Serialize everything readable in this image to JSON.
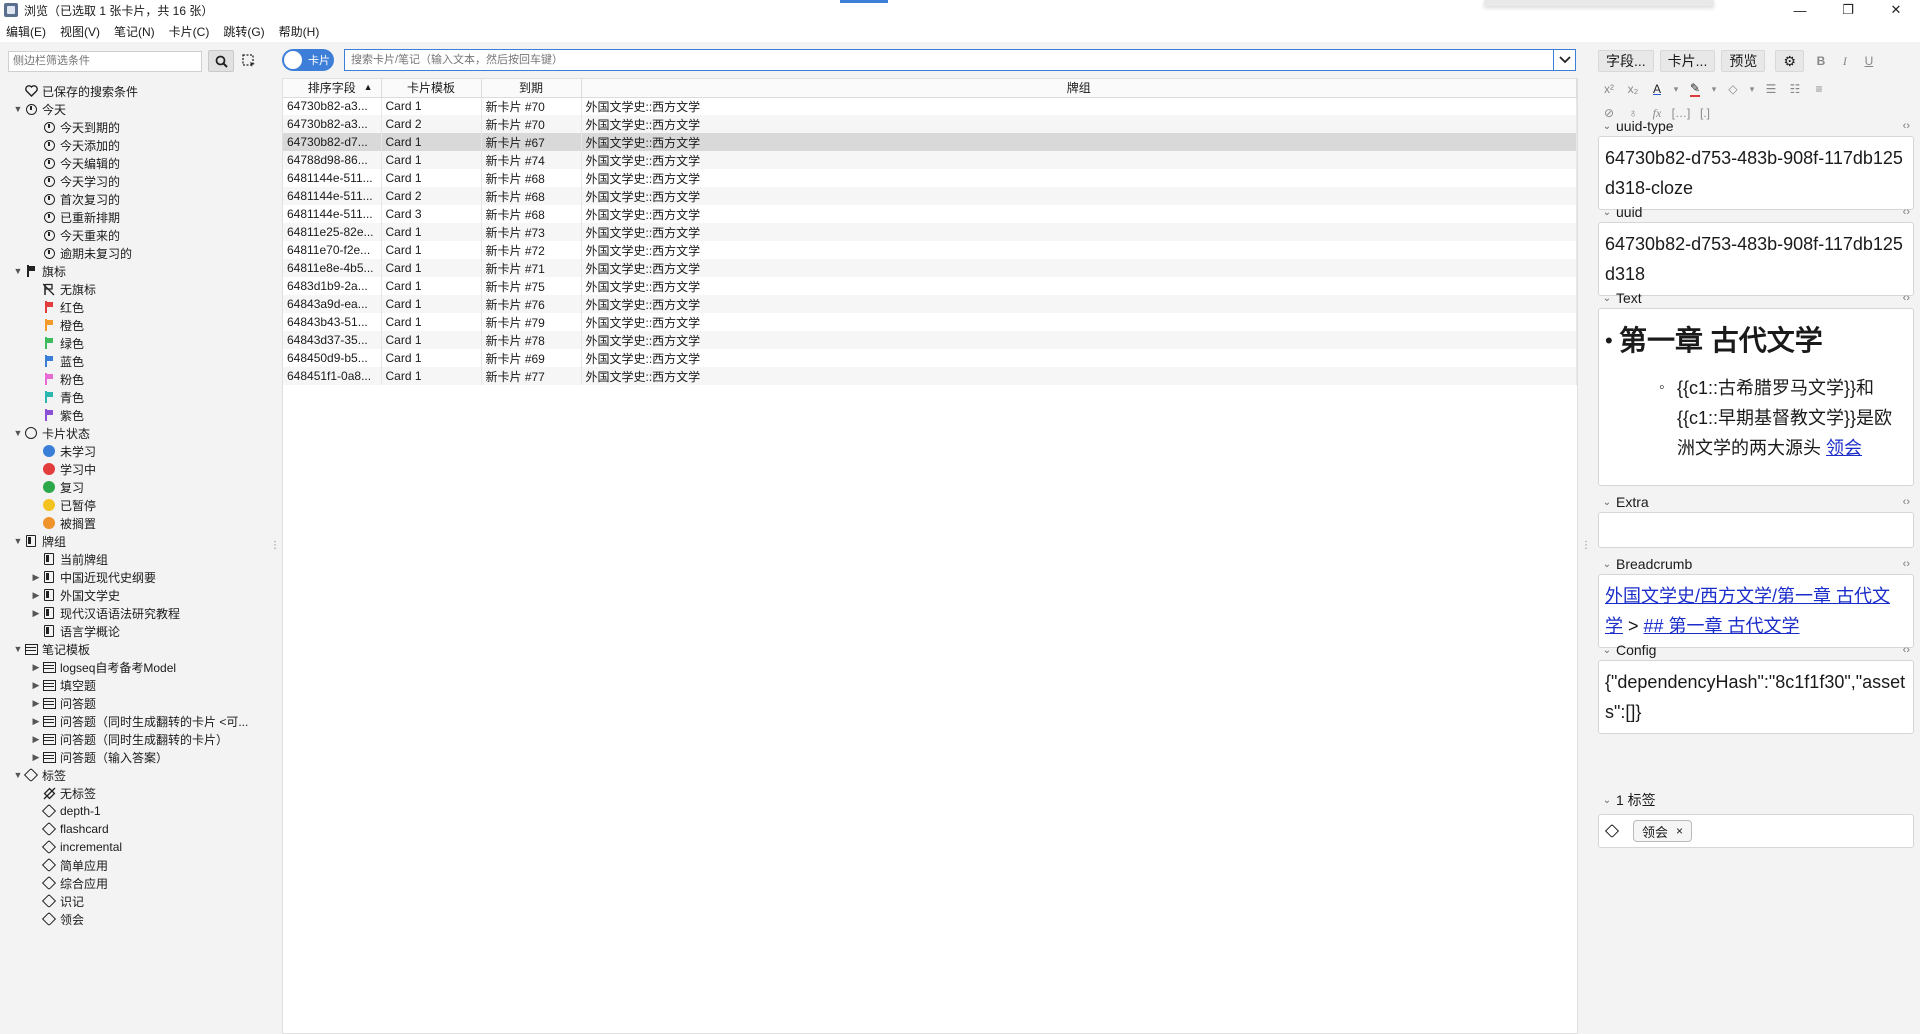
{
  "window": {
    "title": "浏览（已选取 1 张卡片，共 16 张）",
    "controls": [
      "—",
      "❐",
      "✕"
    ]
  },
  "menu": [
    "编辑(E)",
    "视图(V)",
    "笔记(N)",
    "卡片(C)",
    "跳转(G)",
    "帮助(H)"
  ],
  "sidebar": {
    "filter_placeholder": "侧边栏筛选条件",
    "saved_searches": "已保存的搜索条件",
    "today": {
      "label": "今天",
      "items": [
        "今天到期的",
        "今天添加的",
        "今天编辑的",
        "今天学习的",
        "首次复习的",
        "已重新排期",
        "今天重来的",
        "逾期未复习的"
      ]
    },
    "flags": {
      "label": "旗标",
      "items": [
        {
          "label": "无旗标",
          "color": "#222222"
        },
        {
          "label": "红色",
          "color": "#e23c3c"
        },
        {
          "label": "橙色",
          "color": "#f39a2a"
        },
        {
          "label": "绿色",
          "color": "#3dbb5d"
        },
        {
          "label": "蓝色",
          "color": "#3b7ed8"
        },
        {
          "label": "粉色",
          "color": "#e86ad5"
        },
        {
          "label": "青色",
          "color": "#2cb8b0"
        },
        {
          "label": "紫色",
          "color": "#8d4fd6"
        }
      ]
    },
    "card_state": {
      "label": "卡片状态",
      "items": [
        {
          "label": "未学习",
          "color": "#3b7ed8"
        },
        {
          "label": "学习中",
          "color": "#e23c3c"
        },
        {
          "label": "复习",
          "color": "#2aa84a"
        },
        {
          "label": "已暂停",
          "color": "#f5c31f"
        },
        {
          "label": "被搁置",
          "color": "#f0932a"
        }
      ]
    },
    "decks": {
      "label": "牌组",
      "items": [
        "当前牌组",
        "中国近现代史纲要",
        "外国文学史",
        "现代汉语语法研究教程",
        "语言学概论"
      ]
    },
    "note_types": {
      "label": "笔记模板",
      "items": [
        "logseq自考备考Model",
        "填空题",
        "问答题",
        "问答题（同时生成翻转的卡片 <可...",
        "问答题（同时生成翻转的卡片）",
        "问答题（输入答案）"
      ]
    },
    "tags": {
      "label": "标签",
      "items": [
        "无标签",
        "depth-1",
        "flashcard",
        "incremental",
        "简单应用",
        "综合应用",
        "识记",
        "领会"
      ]
    }
  },
  "toolbar": {
    "toggle_label": "卡片",
    "search_placeholder": "搜索卡片/笔记（输入文本，然后按回车键）"
  },
  "table": {
    "columns": [
      "排序字段",
      "卡片模板",
      "到期",
      "牌组"
    ],
    "rows": [
      [
        "64730b82-a3...",
        "Card 1",
        "新卡片 #70",
        "外国文学史::西方文学"
      ],
      [
        "64730b82-a3...",
        "Card 2",
        "新卡片 #70",
        "外国文学史::西方文学"
      ],
      [
        "64730b82-d7...",
        "Card 1",
        "新卡片 #67",
        "外国文学史::西方文学"
      ],
      [
        "64788d98-86...",
        "Card 1",
        "新卡片 #74",
        "外国文学史::西方文学"
      ],
      [
        "6481144e-511...",
        "Card 1",
        "新卡片 #68",
        "外国文学史::西方文学"
      ],
      [
        "6481144e-511...",
        "Card 2",
        "新卡片 #68",
        "外国文学史::西方文学"
      ],
      [
        "6481144e-511...",
        "Card 3",
        "新卡片 #68",
        "外国文学史::西方文学"
      ],
      [
        "64811e25-82e...",
        "Card 1",
        "新卡片 #73",
        "外国文学史::西方文学"
      ],
      [
        "64811e70-f2e...",
        "Card 1",
        "新卡片 #72",
        "外国文学史::西方文学"
      ],
      [
        "64811e8e-4b5...",
        "Card 1",
        "新卡片 #71",
        "外国文学史::西方文学"
      ],
      [
        "6483d1b9-2a...",
        "Card 1",
        "新卡片 #75",
        "外国文学史::西方文学"
      ],
      [
        "64843a9d-ea...",
        "Card 1",
        "新卡片 #76",
        "外国文学史::西方文学"
      ],
      [
        "64843b43-51...",
        "Card 1",
        "新卡片 #79",
        "外国文学史::西方文学"
      ],
      [
        "64843d37-35...",
        "Card 1",
        "新卡片 #78",
        "外国文学史::西方文学"
      ],
      [
        "648450d9-b5...",
        "Card 1",
        "新卡片 #69",
        "外国文学史::西方文学"
      ],
      [
        "648451f1-0a8...",
        "Card 1",
        "新卡片 #77",
        "外国文学史::西方文学"
      ]
    ],
    "selected_row": 2
  },
  "editor": {
    "buttons": [
      "字段...",
      "卡片...",
      "预览"
    ],
    "fields": {
      "uuid_type": {
        "name": "uuid-type",
        "value": "64730b82-d753-483b-908f-117db125d318-cloze"
      },
      "uuid": {
        "name": "uuid",
        "value": "64730b82-d753-483b-908f-117db125d318"
      },
      "text": {
        "name": "Text",
        "heading": "第一章 古代文学",
        "bullet": "{{c1::古希腊罗马文学}}和{{c1::早期基督教文学}}是欧洲文学的两大源头",
        "link": "领会"
      },
      "extra": {
        "name": "Extra",
        "value": ""
      },
      "breadcrumb": {
        "name": "Breadcrumb",
        "link1": "外国文学史/西方文学/第一章 古代文学",
        "sep": " > ",
        "link2": "## 第一章 古代文学"
      },
      "config": {
        "name": "Config",
        "value": "{\"dependencyHash\":\"8c1f1f30\",\"assets\":[]}"
      }
    },
    "tags_count": "1 标签",
    "tag_chip": "领会"
  }
}
